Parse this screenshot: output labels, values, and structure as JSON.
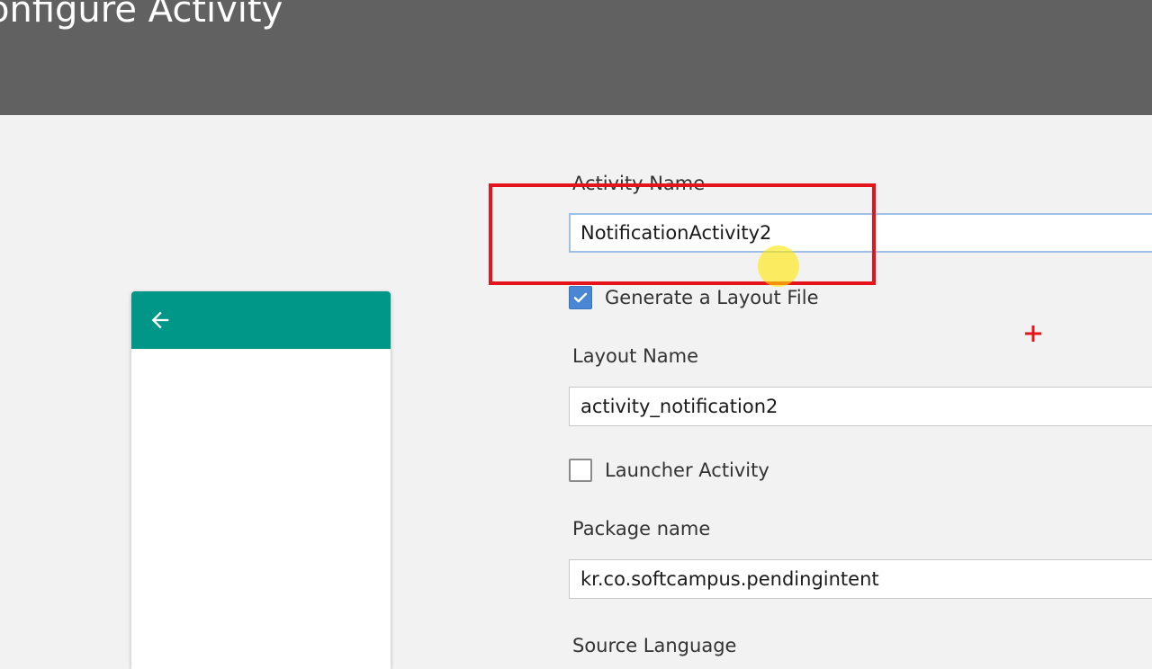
{
  "header": {
    "title": "onfigure Activity"
  },
  "preview": {
    "appbar_color": "#009688",
    "back_icon": "arrow-left-icon"
  },
  "form": {
    "activity_name": {
      "label": "Activity Name",
      "value": "NotificationActivity2"
    },
    "generate_layout": {
      "label": "Generate a Layout File",
      "checked": true
    },
    "layout_name": {
      "label": "Layout Name",
      "value": "activity_notification2"
    },
    "launcher_activity": {
      "label": "Launcher Activity",
      "checked": false
    },
    "package_name": {
      "label": "Package name",
      "value": "kr.co.softcampus.pendingintent"
    },
    "source_language": {
      "label": "Source Language"
    }
  },
  "colors": {
    "header_bg": "#616161",
    "page_bg": "#f2f2f2",
    "highlight": "#e5141b",
    "checkbox_checked": "#4a86d4"
  }
}
